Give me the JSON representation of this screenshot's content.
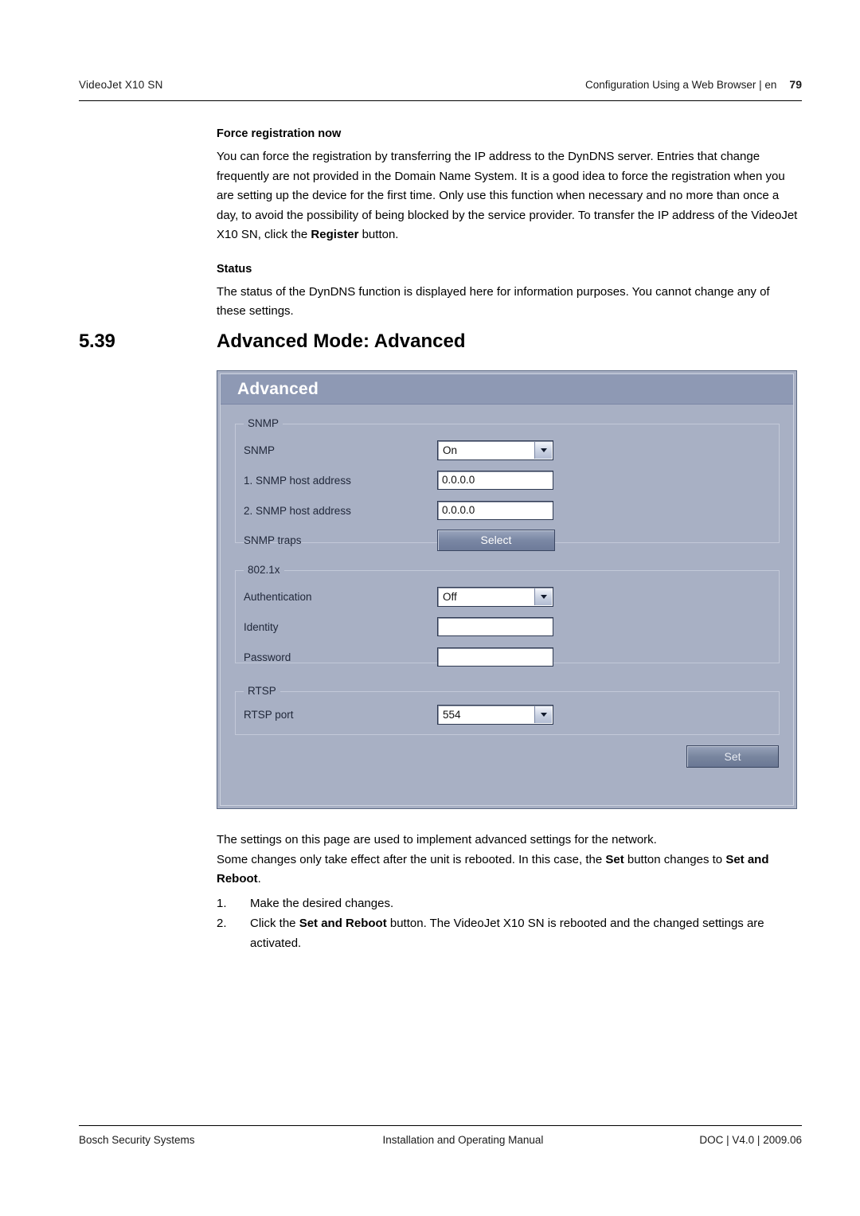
{
  "header": {
    "left": "VideoJet X10 SN",
    "right": "Configuration Using a Web Browser | en",
    "page_number": "79"
  },
  "content": {
    "force_registration_heading": "Force registration now",
    "force_registration_body_1": "You can force the registration by transferring the IP address to the DynDNS server. Entries that change frequently are not provided in the Domain Name System. It is a good idea to force the registration when you are setting up the device for the first time. Only use this function when necessary and no more than once a day, to avoid the possibility of being blocked by the service provider. To transfer the IP address of the VideoJet X10 SN, click the ",
    "force_registration_body_bold": "Register",
    "force_registration_body_2": " button.",
    "status_heading": "Status",
    "status_body": "The status of the DynDNS function is displayed here for information purposes. You cannot change any of these settings."
  },
  "section": {
    "number": "5.39",
    "title": "Advanced Mode: Advanced"
  },
  "screenshot": {
    "title": "Advanced",
    "groups": [
      {
        "legend": "SNMP",
        "fields": [
          {
            "label": "SNMP",
            "type": "select",
            "value": "On"
          },
          {
            "label": "1. SNMP host address",
            "type": "text",
            "value": "0.0.0.0"
          },
          {
            "label": "2. SNMP host address",
            "type": "text",
            "value": "0.0.0.0"
          },
          {
            "label": "SNMP traps",
            "type": "button",
            "value": "Select"
          }
        ]
      },
      {
        "legend": "802.1x",
        "fields": [
          {
            "label": "Authentication",
            "type": "select",
            "value": "Off"
          },
          {
            "label": "Identity",
            "type": "text",
            "value": ""
          },
          {
            "label": "Password",
            "type": "text",
            "value": ""
          }
        ]
      },
      {
        "legend": "RTSP",
        "fields": [
          {
            "label": "RTSP port",
            "type": "select",
            "value": "554"
          }
        ]
      }
    ],
    "set_button": "Set"
  },
  "after": {
    "para_1": "The settings on this page are used to implement advanced settings for the network.",
    "para_2_a": "Some changes only take effect after the unit is rebooted. In this case, the ",
    "para_2_bold": "Set",
    "para_2_b": " button changes to ",
    "para_2_bold_2": "Set and Reboot",
    "para_2_c": ".",
    "steps": [
      {
        "num": "1.",
        "text_a": "Make the desired changes.",
        "bold": "",
        "text_b": ""
      },
      {
        "num": "2.",
        "text_a": "Click the ",
        "bold": "Set and Reboot",
        "text_b": " button. The VideoJet X10 SN is rebooted and the changed settings are activated."
      }
    ]
  },
  "footer": {
    "left": "Bosch Security Systems",
    "middle": "Installation and Operating Manual",
    "right": "DOC | V4.0 | 2009.06"
  }
}
